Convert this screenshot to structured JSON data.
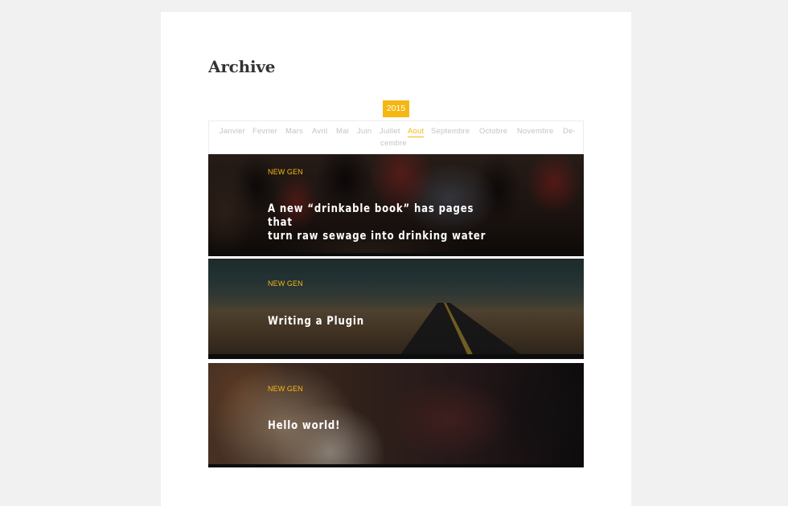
{
  "page": {
    "title": "Archive"
  },
  "archive": {
    "year": "2015",
    "months": [
      {
        "label": "Janvier",
        "active": false
      },
      {
        "label": "Fevrier",
        "active": false
      },
      {
        "label": "Mars",
        "active": false
      },
      {
        "label": "Avril",
        "active": false
      },
      {
        "label": "Mai",
        "active": false
      },
      {
        "label": "Juin",
        "active": false
      },
      {
        "label": "Juillet",
        "active": false
      },
      {
        "label": "Aout",
        "active": true
      },
      {
        "label": "Septembre",
        "active": false
      },
      {
        "label": "Octobre",
        "active": false
      },
      {
        "label": "Novembre",
        "active": false
      },
      {
        "label": "De-",
        "active": false
      },
      {
        "label": "cembre",
        "active": false
      }
    ]
  },
  "posts": [
    {
      "category": "New Gen",
      "title_line1": "A new “drinkable book” has pages that",
      "title_line2": "turn raw sewage into drinking water"
    },
    {
      "category": "New Gen",
      "title": "Writing a Plugin"
    },
    {
      "category": "New Gen",
      "title": "Hello world!"
    }
  ],
  "colors": {
    "accent": "#f5b712",
    "background": "#f1f1f1",
    "card": "#ffffff",
    "heading": "#333333"
  }
}
